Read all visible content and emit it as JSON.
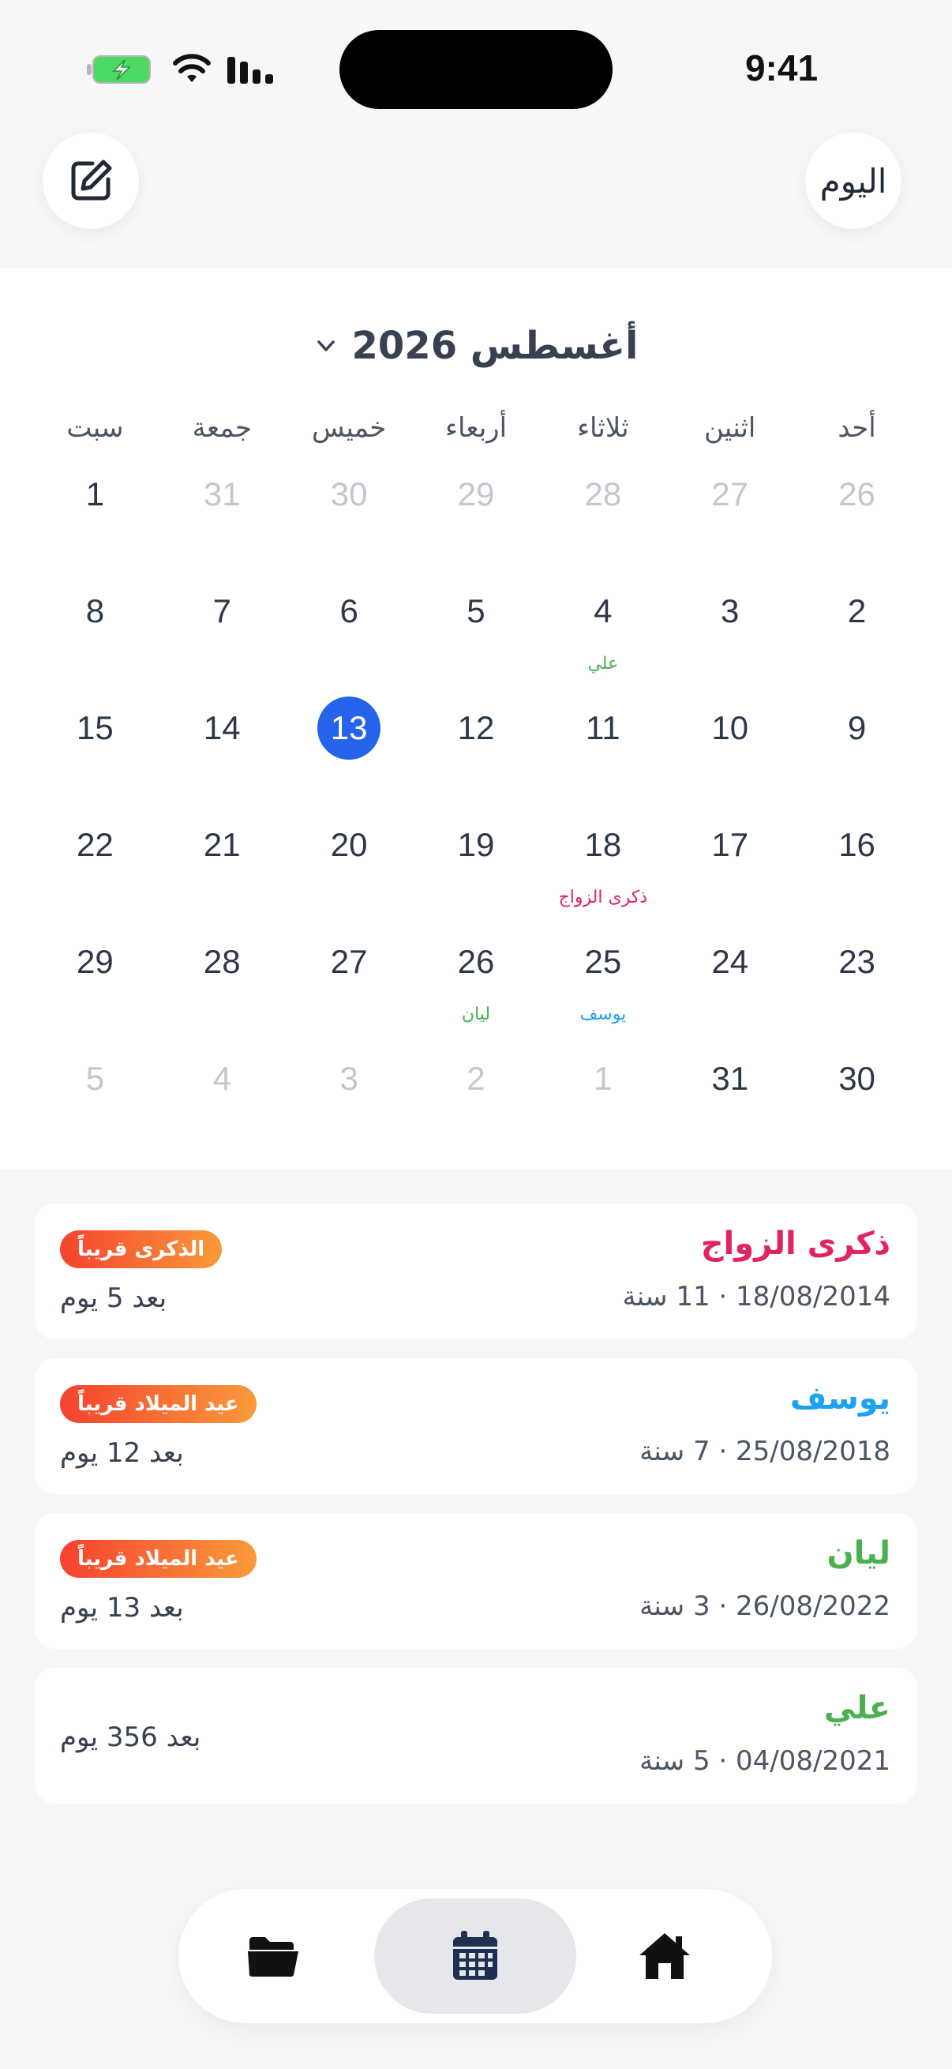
{
  "status": {
    "time": "9:41"
  },
  "header": {
    "today_label": "اليوم"
  },
  "calendar": {
    "month_title": "أغسطس 2026",
    "weekdays": [
      "أحد",
      "اثنين",
      "ثلاثاء",
      "أربعاء",
      "خميس",
      "جمعة",
      "سبت"
    ],
    "weeks": [
      [
        {
          "n": "26",
          "m": true
        },
        {
          "n": "27",
          "m": true
        },
        {
          "n": "28",
          "m": true
        },
        {
          "n": "29",
          "m": true
        },
        {
          "n": "30",
          "m": true
        },
        {
          "n": "31",
          "m": true
        },
        {
          "n": "1"
        }
      ],
      [
        {
          "n": "2"
        },
        {
          "n": "3"
        },
        {
          "n": "4",
          "e": "علي",
          "c": "#4caf50"
        },
        {
          "n": "5"
        },
        {
          "n": "6"
        },
        {
          "n": "7"
        },
        {
          "n": "8"
        }
      ],
      [
        {
          "n": "9"
        },
        {
          "n": "10"
        },
        {
          "n": "11"
        },
        {
          "n": "12"
        },
        {
          "n": "13",
          "t": true
        },
        {
          "n": "14"
        },
        {
          "n": "15"
        }
      ],
      [
        {
          "n": "16"
        },
        {
          "n": "17"
        },
        {
          "n": "18",
          "e": "ذكرى الزواج",
          "c": "#e0245e"
        },
        {
          "n": "19"
        },
        {
          "n": "20"
        },
        {
          "n": "21"
        },
        {
          "n": "22"
        }
      ],
      [
        {
          "n": "23"
        },
        {
          "n": "24"
        },
        {
          "n": "25",
          "e": "يوسف",
          "c": "#1da1f2"
        },
        {
          "n": "26",
          "e": "ليان",
          "c": "#4caf50"
        },
        {
          "n": "27"
        },
        {
          "n": "28"
        },
        {
          "n": "29"
        }
      ],
      [
        {
          "n": "30"
        },
        {
          "n": "31"
        },
        {
          "n": "1",
          "m": true
        },
        {
          "n": "2",
          "m": true
        },
        {
          "n": "3",
          "m": true
        },
        {
          "n": "4",
          "m": true
        },
        {
          "n": "5",
          "m": true
        }
      ]
    ]
  },
  "events": [
    {
      "name": "ذكرى الزواج",
      "color": "#e0245e",
      "meta": "18/08/2014 · 11 سنة",
      "badge": "الذكرى قريباً",
      "countdown": "بعد 5 يوم"
    },
    {
      "name": "يوسف",
      "color": "#1da1f2",
      "meta": "25/08/2018 · 7 سنة",
      "badge": "عيد الميلاد قريباً",
      "countdown": "بعد 12 يوم"
    },
    {
      "name": "ليان",
      "color": "#4caf50",
      "meta": "26/08/2022 · 3 سنة",
      "badge": "عيد الميلاد قريباً",
      "countdown": "بعد 13 يوم"
    },
    {
      "name": "علي",
      "color": "#4caf50",
      "meta": "04/08/2021 · 5 سنة",
      "badge": "",
      "countdown": "بعد 356 يوم"
    }
  ],
  "nav": {
    "files_icon": "folder-icon",
    "calendar_icon": "calendar-icon",
    "home_icon": "home-icon"
  }
}
